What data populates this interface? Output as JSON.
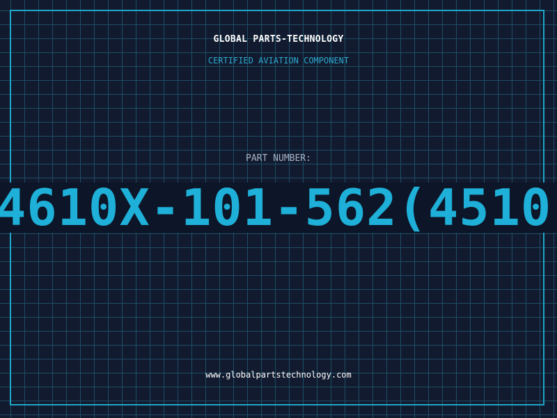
{
  "header": {
    "company_name": "GLOBAL PARTS-TECHNOLOGY",
    "subtitle": "CERTIFIED AVIATION COMPONENT"
  },
  "part": {
    "label": "PART NUMBER:",
    "number": "4610X-101-562(4510"
  },
  "footer": {
    "website": "www.globalpartstechnology.com"
  },
  "colors": {
    "background": "#111a2e",
    "grid": "#1e4e66",
    "frame": "#1ea7c9",
    "accent": "#1eb0d8",
    "label": "#a8b4c6",
    "title": "#ffffff"
  }
}
